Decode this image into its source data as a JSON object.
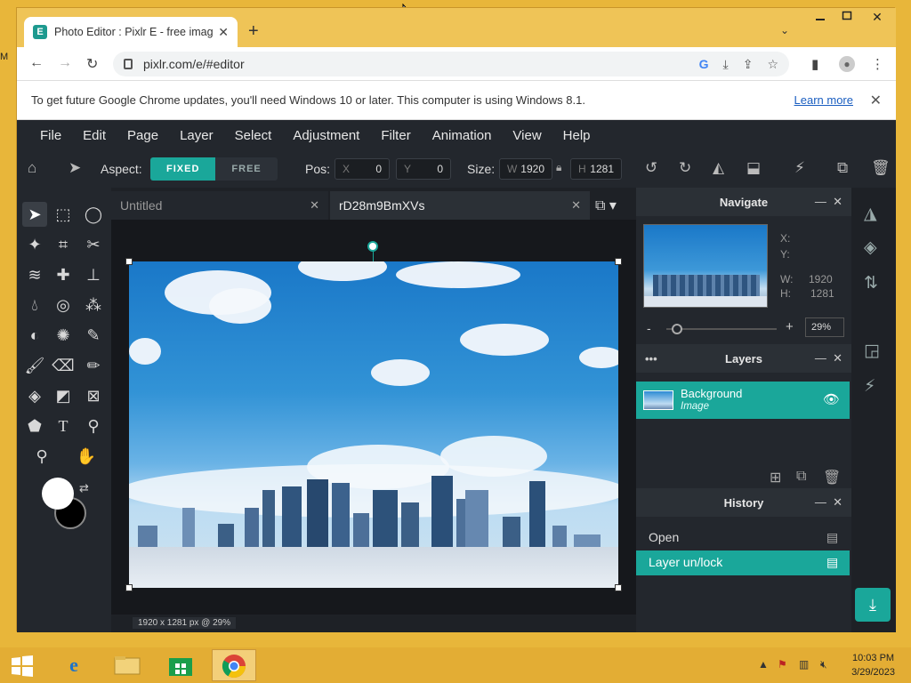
{
  "browser": {
    "tab_title": "Photo Editor : Pixlr E - free image",
    "tab_favicon": "E",
    "url": "pixlr.com/e/#editor",
    "info_message": "To get future Google Chrome updates, you'll need Windows 10 or later. This computer is using Windows 8.1.",
    "learn_more": "Learn more"
  },
  "menu": [
    "File",
    "Edit",
    "Page",
    "Layer",
    "Select",
    "Adjustment",
    "Filter",
    "Animation",
    "View",
    "Help"
  ],
  "toolbar": {
    "aspect_label": "Aspect:",
    "fixed": "FIXED",
    "free": "FREE",
    "pos_label": "Pos:",
    "x_key": "X",
    "x_val": "0",
    "y_key": "Y",
    "y_val": "0",
    "size_label": "Size:",
    "w_key": "W",
    "w_val": "1920",
    "h_key": "H",
    "h_val": "1281"
  },
  "doc_tabs": [
    {
      "label": "Untitled"
    },
    {
      "label": "rD28m9BmXVs"
    }
  ],
  "status": "1920 x 1281 px @ 29%",
  "navigate": {
    "title": "Navigate",
    "x_label": "X:",
    "y_label": "Y:",
    "w_label": "W:",
    "w_val": "1920",
    "h_label": "H:",
    "h_val": "1281",
    "zoom": "29%",
    "zoom_level": 0.1
  },
  "layers": {
    "title": "Layers",
    "items": [
      {
        "name": "Background",
        "type": "Image"
      }
    ]
  },
  "history": {
    "title": "History",
    "items": [
      "Open",
      "Layer un/lock"
    ]
  },
  "taskbar": {
    "time": "10:03 PM",
    "date": "3/29/2023"
  },
  "colors": {
    "accent": "#1aa79a",
    "app_bg": "#1e2126",
    "desktop": "#e8b63a"
  }
}
